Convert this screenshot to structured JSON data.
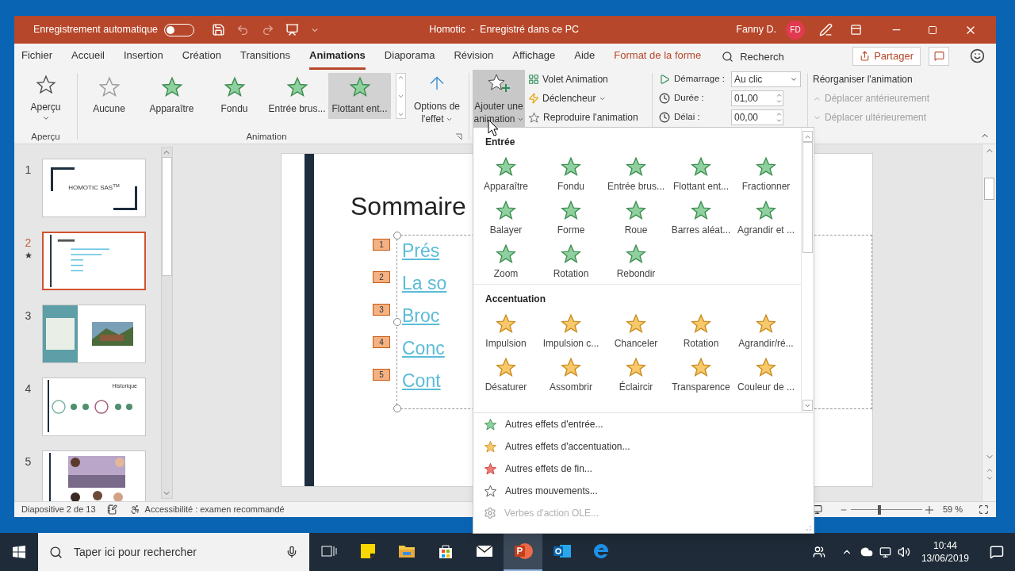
{
  "title_bar": {
    "autosave_label": "Enregistrement automatique",
    "autosave_on": false,
    "title": "Homotic  -  Enregistré dans ce PC",
    "user_name": "Fanny D.",
    "user_initials": "FD"
  },
  "tabs": [
    {
      "label": "Fichier",
      "selected": false,
      "kind": "plain"
    },
    {
      "label": "Accueil",
      "selected": false,
      "kind": "plain"
    },
    {
      "label": "Insertion",
      "selected": false,
      "kind": "plain"
    },
    {
      "label": "Création",
      "selected": false,
      "kind": "plain"
    },
    {
      "label": "Transitions",
      "selected": false,
      "kind": "plain"
    },
    {
      "label": "Animations",
      "selected": true,
      "kind": "plain"
    },
    {
      "label": "Diaporama",
      "selected": false,
      "kind": "plain"
    },
    {
      "label": "Révision",
      "selected": false,
      "kind": "plain"
    },
    {
      "label": "Affichage",
      "selected": false,
      "kind": "plain"
    },
    {
      "label": "Aide",
      "selected": false,
      "kind": "plain"
    },
    {
      "label": "Format de la forme",
      "selected": false,
      "kind": "contextual"
    }
  ],
  "search": {
    "label": "Recherch"
  },
  "share_button": "Partager",
  "ribbon": {
    "preview": {
      "label": "Aperçu",
      "group": "Aperçu"
    },
    "gallery": {
      "group": "Animation",
      "items": [
        {
          "label": "Aucune",
          "kind": "none",
          "selected": false
        },
        {
          "label": "Apparaître",
          "kind": "entrance",
          "selected": false
        },
        {
          "label": "Fondu",
          "kind": "entrance",
          "selected": false
        },
        {
          "label": "Entrée brus...",
          "kind": "entrance",
          "selected": false
        },
        {
          "label": "Flottant ent...",
          "kind": "entrance",
          "selected": true
        }
      ]
    },
    "effect_options": {
      "line1": "Options de",
      "line2": "l'effet"
    },
    "add_animation": {
      "line1": "Ajouter une",
      "line2": "animation"
    },
    "advanced": [
      {
        "label": "Volet Animation",
        "kind": "pane",
        "dropdown": false
      },
      {
        "label": "Déclencheur",
        "kind": "trigger",
        "dropdown": true
      },
      {
        "label": "Reproduire l'animation",
        "kind": "painter",
        "dropdown": false
      }
    ],
    "timing": [
      {
        "label": "Démarrage :",
        "value": "Au clic",
        "kind": "select"
      },
      {
        "label": "Durée :",
        "value": "01,00",
        "kind": "spinner"
      },
      {
        "label": "Délai :",
        "value": "00,00",
        "kind": "spinner"
      }
    ],
    "reorder": {
      "title": "Réorganiser l'animation",
      "items": [
        {
          "label": "Déplacer antérieurement",
          "kind": "up",
          "disabled": true
        },
        {
          "label": "Déplacer ultérieurement",
          "kind": "down",
          "disabled": true
        }
      ]
    }
  },
  "slides": [
    {
      "number": "1",
      "selected": false,
      "animated": false,
      "kind": "title",
      "title": "HOMOTIC SAS$^{TM}$"
    },
    {
      "number": "2",
      "selected": true,
      "animated": true,
      "kind": "summary"
    },
    {
      "number": "3",
      "selected": false,
      "animated": false,
      "kind": "about"
    },
    {
      "number": "4",
      "selected": false,
      "animated": false,
      "kind": "timeline",
      "title": "Historique"
    },
    {
      "number": "5",
      "selected": false,
      "animated": false,
      "kind": "team"
    }
  ],
  "slide": {
    "title": "Sommaire",
    "items": [
      {
        "number": "1",
        "text": "Prés"
      },
      {
        "number": "2",
        "text": "La so"
      },
      {
        "number": "3",
        "text": "Broc"
      },
      {
        "number": "4",
        "text": "Conc"
      },
      {
        "number": "5",
        "text": "Cont"
      }
    ]
  },
  "animation_menu": {
    "sections": [
      {
        "title": "Entrée",
        "kind": "entrance",
        "effects": [
          "Apparaître",
          "Fondu",
          "Entrée brus...",
          "Flottant ent...",
          "Fractionner",
          "Balayer",
          "Forme",
          "Roue",
          "Barres aléat...",
          "Agrandir et ...",
          "Zoom",
          "Rotation",
          "Rebondir"
        ]
      },
      {
        "title": "Accentuation",
        "kind": "emphasis",
        "effects": [
          "Impulsion",
          "Impulsion c...",
          "Chanceler",
          "Rotation",
          "Agrandir/ré...",
          "Désaturer",
          "Assombrir",
          "Éclaircir",
          "Transparence",
          "Couleur de ..."
        ]
      }
    ],
    "commands": [
      {
        "label": "Autres effets d'entrée...",
        "kind": "entrance",
        "disabled": false
      },
      {
        "label": "Autres effets d'accentuation...",
        "kind": "emphasis",
        "disabled": false
      },
      {
        "label": "Autres effets de fin...",
        "kind": "exit",
        "disabled": false
      },
      {
        "label": "Autres mouvements...",
        "kind": "motion",
        "disabled": false
      },
      {
        "label": "Verbes d'action OLE...",
        "kind": "ole",
        "disabled": true
      }
    ]
  },
  "status_bar": {
    "slide_info": "Diapositive 2 de 13",
    "accessibility": "Accessibilité : examen recommandé",
    "zoom": "59 %",
    "zoom_slider": {
      "level": 0.4
    }
  },
  "taskbar": {
    "search_placeholder": "Taper ici pour rechercher",
    "apps": [
      {
        "kind": "task-view",
        "selected": false
      },
      {
        "kind": "sticky-notes",
        "selected": false
      },
      {
        "kind": "explorer",
        "selected": false
      },
      {
        "kind": "store",
        "selected": false
      },
      {
        "kind": "mail",
        "selected": false
      },
      {
        "kind": "powerpoint",
        "selected": true
      },
      {
        "kind": "outlook",
        "selected": false
      },
      {
        "kind": "edge",
        "selected": false
      }
    ],
    "time": "10:44",
    "date": "13/06/2019"
  }
}
